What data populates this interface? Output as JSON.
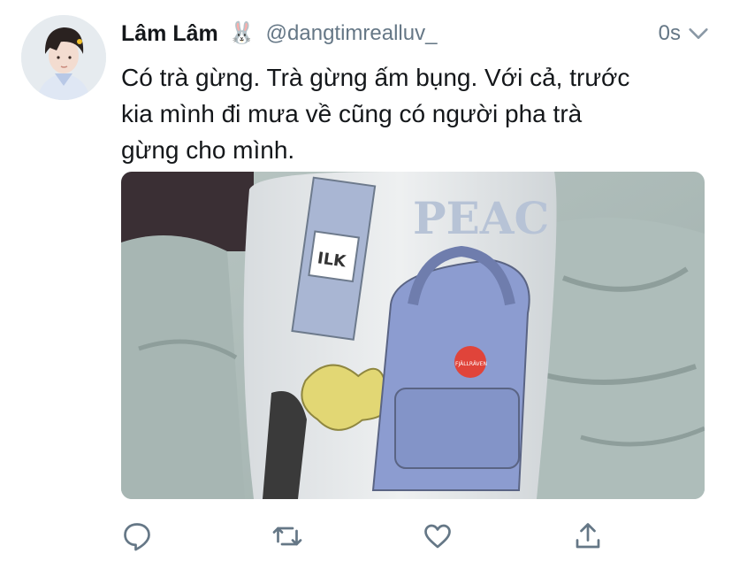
{
  "tweet": {
    "author_name": "Lâm Lâm",
    "author_emoji": "🐰",
    "handle": "@dangtimrealluv_",
    "timestamp": "0s",
    "text": "Có trà gừng. Trà gừng ấm bụng. Với cả, trước\nkia mình đi mưa về cũng có người pha trà\ngừng cho mình.",
    "media": {
      "sticker_top_text": "PEAC",
      "milk_carton_text": "ILK",
      "badge_text": "FJÄLLRÄVEN"
    }
  },
  "icons": [
    "chevron-down-icon",
    "reply-icon",
    "retweet-icon",
    "like-icon",
    "share-icon"
  ],
  "colors": {
    "text": "#14171a",
    "secondary": "#657786",
    "icon": "#657786"
  }
}
